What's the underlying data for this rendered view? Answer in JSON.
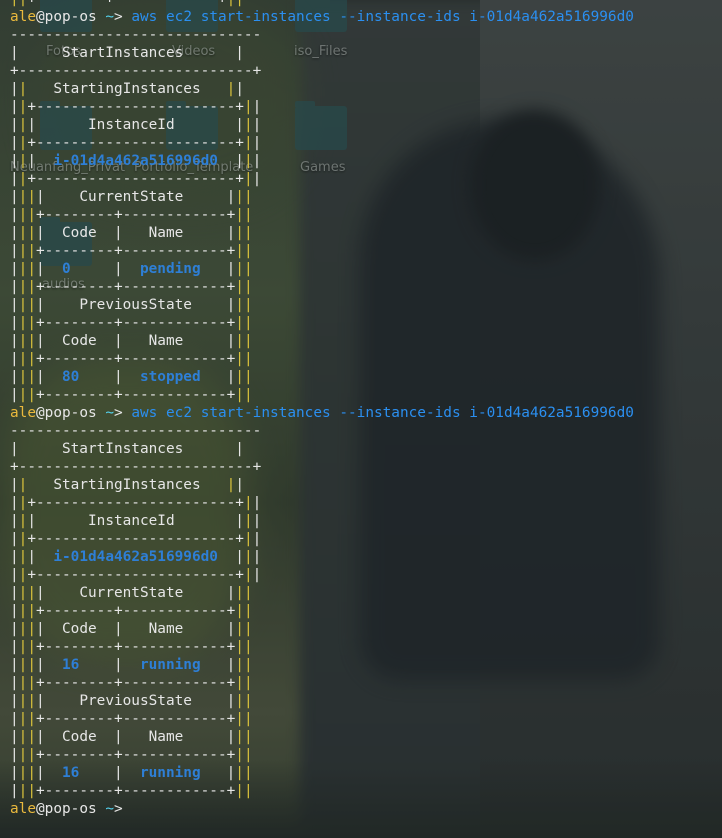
{
  "desktop": {
    "icons": [
      {
        "label": "Fotos"
      },
      {
        "label": "Videos"
      },
      {
        "label": "iso_Files"
      },
      {
        "label": "Neuanfang_Privat"
      },
      {
        "label": "Portfolio_Template"
      },
      {
        "label": "Games"
      },
      {
        "label": "audios"
      }
    ]
  },
  "prompt": {
    "user": "ale",
    "at_host": "@pop-os",
    "cwd": "~",
    "symbol": ">"
  },
  "commands": [
    {
      "program": "aws",
      "service": "ec2",
      "action": "start-instances",
      "flag": "--instance-ids",
      "instance_id": "i-01d4a462a516996d0"
    },
    {
      "program": "aws",
      "service": "ec2",
      "action": "start-instances",
      "flag": "--instance-ids",
      "instance_id": "i-01d4a462a516996d0"
    }
  ],
  "output_labels": {
    "start_instances": "StartInstances",
    "starting_instances": "StartingInstances",
    "instance_id": "InstanceId",
    "current_state": "CurrentState",
    "previous_state": "PreviousState",
    "code": "Code",
    "name": "Name"
  },
  "results": [
    {
      "instance_id": "i-01d4a462a516996d0",
      "current_code": "0",
      "current_name": "pending",
      "previous_code": "80",
      "previous_name": "stopped"
    },
    {
      "instance_id": "i-01d4a462a516996d0",
      "current_code": "16",
      "current_name": "running",
      "previous_code": "16",
      "previous_name": "running"
    }
  ]
}
